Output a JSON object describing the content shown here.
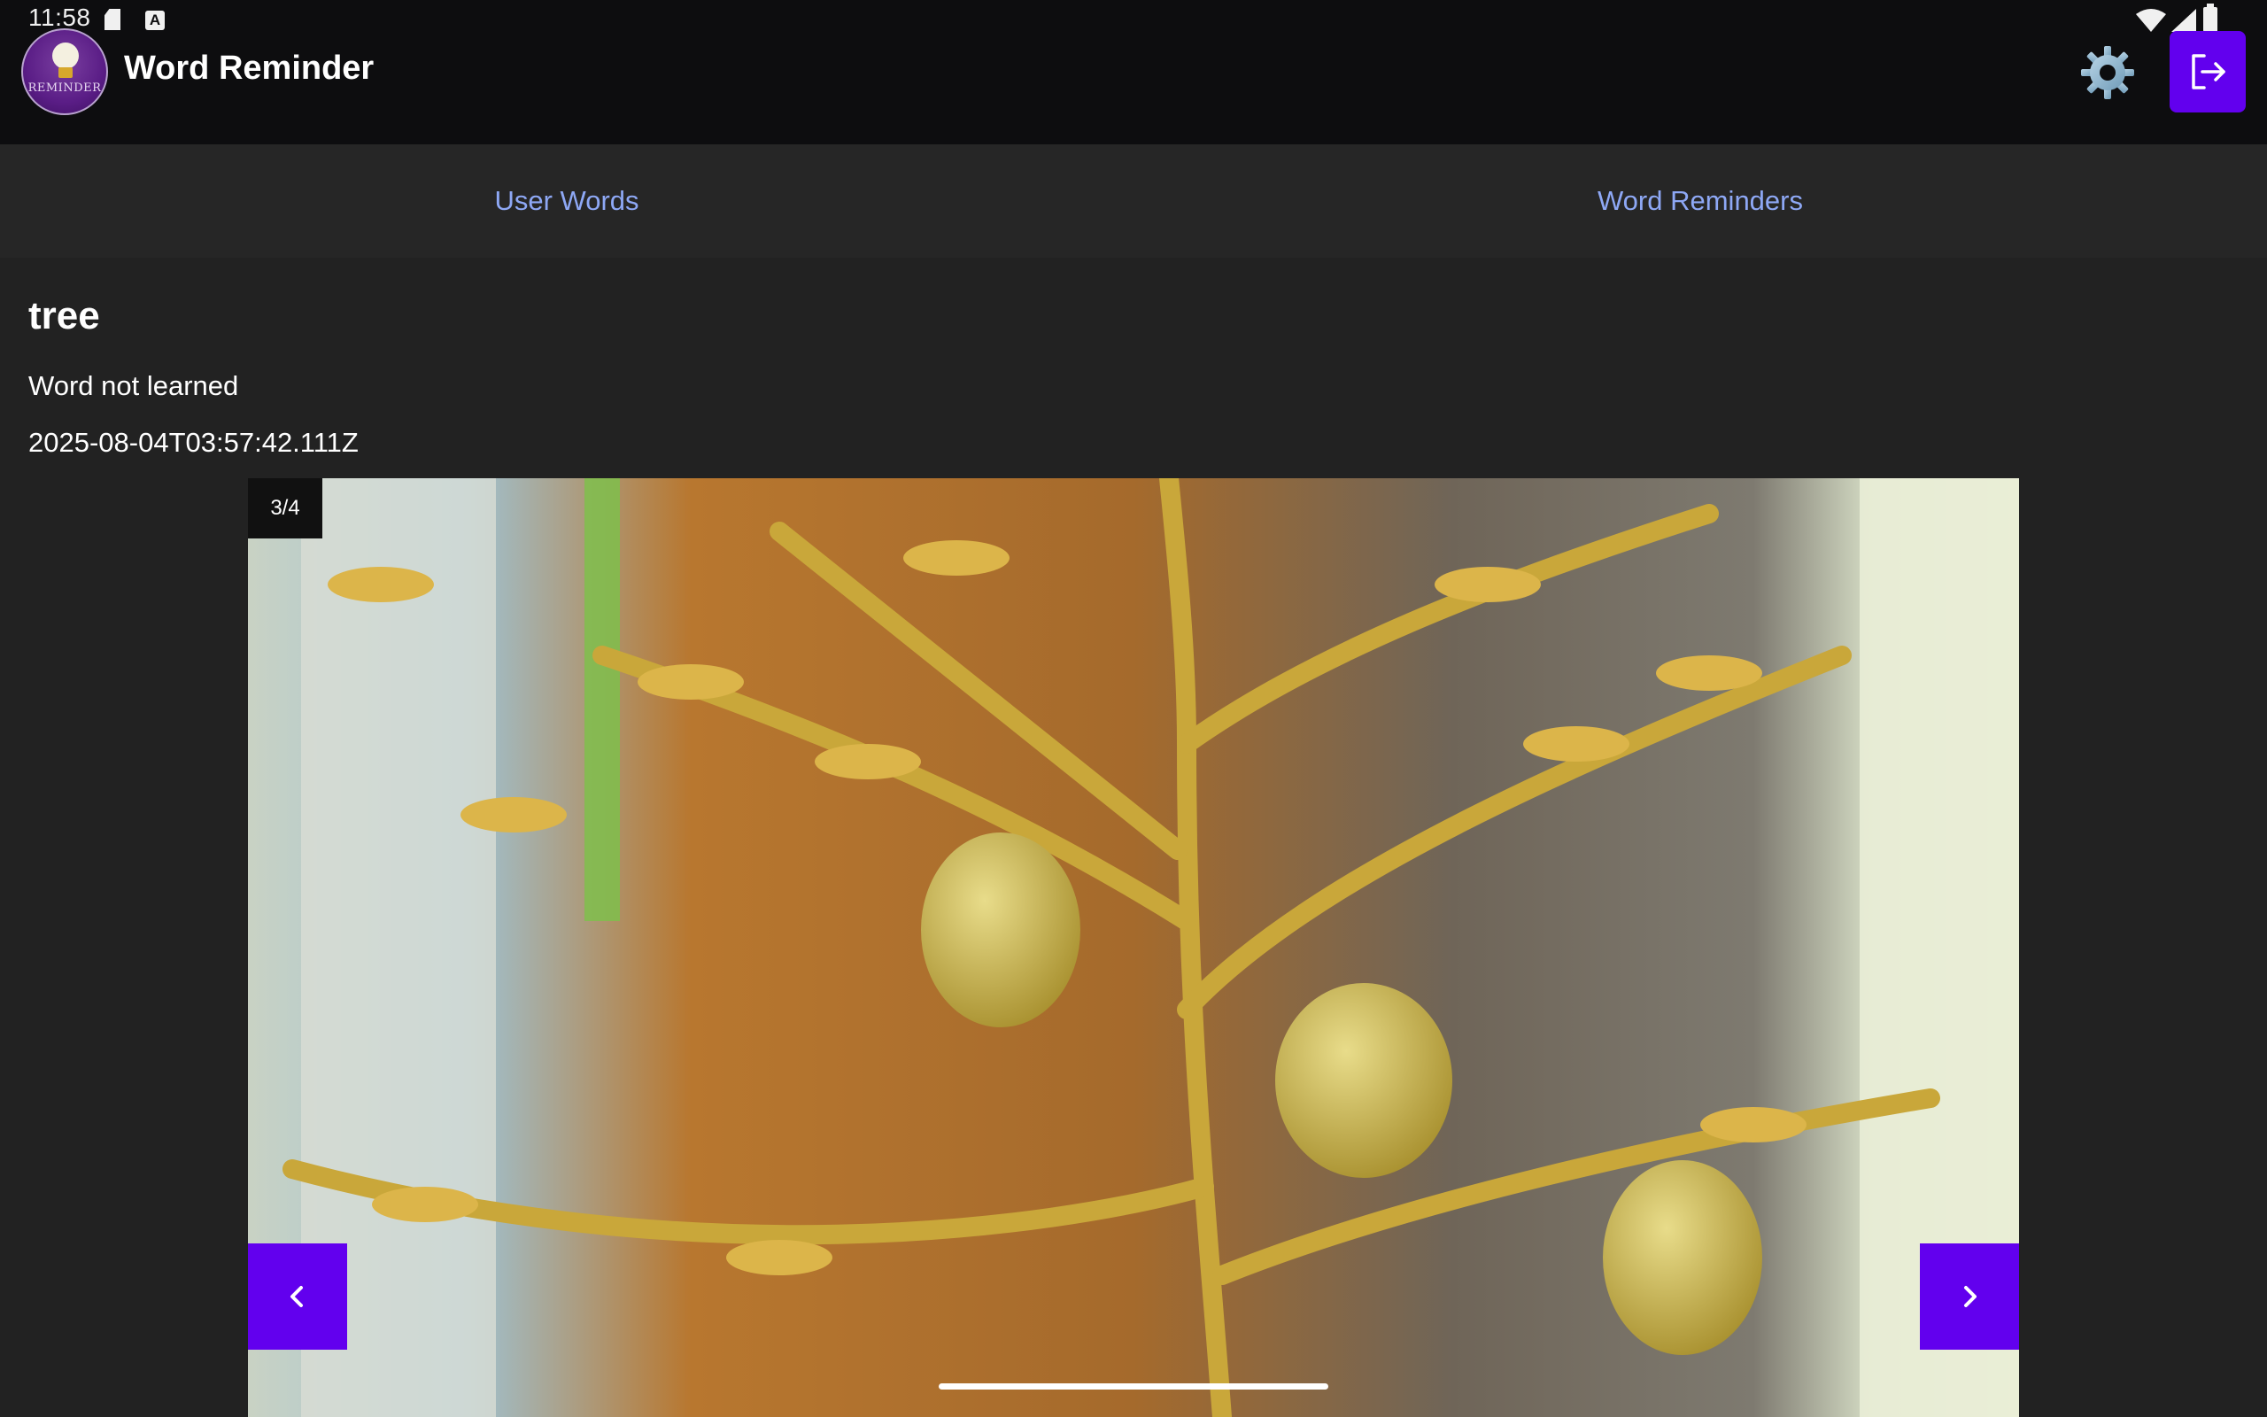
{
  "status_bar": {
    "time": "11:58",
    "icons": [
      "sd-card-icon",
      "keyboard-a-icon",
      "wifi-icon",
      "cellular-signal-icon",
      "battery-icon"
    ]
  },
  "app_bar": {
    "title": "Word Reminder",
    "logo_text": "REMINDER",
    "settings_icon": "gear-icon",
    "logout_icon": "logout-icon",
    "accent_color": "#6200ee"
  },
  "tabs": [
    {
      "label": "User Words"
    },
    {
      "label": "Word Reminders"
    }
  ],
  "word": {
    "title": "tree",
    "status": "Word not learned",
    "created_at": "2025-08-04T03:57:42.111Z"
  },
  "carousel": {
    "counter": "3/4",
    "current": 3,
    "total": 4,
    "prev_icon": "chevron-left-icon",
    "next_icon": "chevron-right-icon"
  }
}
